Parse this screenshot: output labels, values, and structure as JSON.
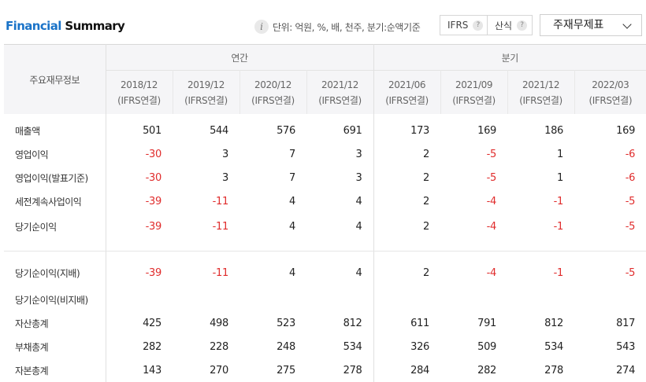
{
  "header": {
    "title_accent": "Financial",
    "title_rest": "Summary",
    "info_icon": "i",
    "unit_text": "단위: 억원, %, 배, 천주, 분기:순액기준",
    "toggle_ifrs": "IFRS",
    "toggle_formula": "산식",
    "help_glyph": "?",
    "select_value": "주재무제표"
  },
  "table": {
    "row_header": "주요재무정보",
    "group_annual": "연간",
    "group_quarter": "분기",
    "columns": [
      {
        "date": "2018/12",
        "basis": "(IFRS연결)"
      },
      {
        "date": "2019/12",
        "basis": "(IFRS연결)"
      },
      {
        "date": "2020/12",
        "basis": "(IFRS연결)"
      },
      {
        "date": "2021/12",
        "basis": "(IFRS연결)"
      },
      {
        "date": "2021/06",
        "basis": "(IFRS연결)"
      },
      {
        "date": "2021/09",
        "basis": "(IFRS연결)"
      },
      {
        "date": "2021/12",
        "basis": "(IFRS연결)"
      },
      {
        "date": "2022/03",
        "basis": "(IFRS연결)"
      }
    ],
    "group1": [
      {
        "label": "매출액",
        "values": [
          "501",
          "544",
          "576",
          "691",
          "173",
          "169",
          "186",
          "169"
        ]
      },
      {
        "label": "영업이익",
        "values": [
          "-30",
          "3",
          "7",
          "3",
          "2",
          "-5",
          "1",
          "-6"
        ]
      },
      {
        "label": "영업이익(발표기준)",
        "values": [
          "-30",
          "3",
          "7",
          "3",
          "2",
          "-5",
          "1",
          "-6"
        ]
      },
      {
        "label": "세전계속사업이익",
        "values": [
          "-39",
          "-11",
          "4",
          "4",
          "2",
          "-4",
          "-1",
          "-5"
        ]
      },
      {
        "label": "당기순이익",
        "values": [
          "-39",
          "-11",
          "4",
          "4",
          "2",
          "-4",
          "-1",
          "-5"
        ]
      }
    ],
    "group2": [
      {
        "label": "당기순이익(지배)",
        "values": [
          "-39",
          "-11",
          "4",
          "4",
          "2",
          "-4",
          "-1",
          "-5"
        ]
      },
      {
        "label": "당기순이익(비지배)",
        "values": [
          "",
          "",
          "",
          "",
          "",
          "",
          "",
          ""
        ]
      },
      {
        "label": "자산총계",
        "values": [
          "425",
          "498",
          "523",
          "812",
          "611",
          "791",
          "812",
          "817"
        ]
      },
      {
        "label": "부채총계",
        "values": [
          "282",
          "228",
          "248",
          "534",
          "326",
          "509",
          "534",
          "543"
        ]
      },
      {
        "label": "자본총계",
        "values": [
          "143",
          "270",
          "275",
          "278",
          "284",
          "282",
          "278",
          "274"
        ]
      }
    ]
  },
  "colors": {
    "accent": "#1a73c8",
    "negative": "#e02c2c",
    "header_bg": "#f5f5f7"
  }
}
